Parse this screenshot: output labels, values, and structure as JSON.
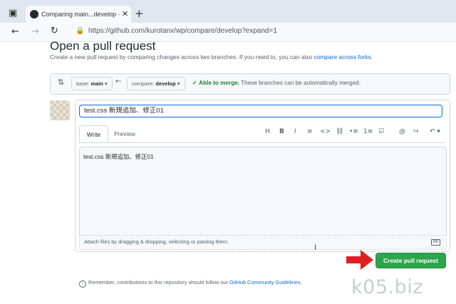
{
  "browser": {
    "tab_title": "Comparing main...develop · kuro",
    "url": "https://github.com/kurotanx/wp/compare/develop?expand=1",
    "icons": [
      "sidebar-toggle-icon",
      "github-favicon-icon",
      "close-tab-icon",
      "new-tab-icon",
      "back-icon",
      "forward-icon",
      "reload-icon",
      "lock-icon"
    ]
  },
  "page": {
    "heading": "Open a pull request",
    "subtitle_text": "Create a new pull request by comparing changes across two branches. If you need to, you can also ",
    "subtitle_link": "compare across forks",
    "subtitle_end": "."
  },
  "compare": {
    "base_prefix": "base:",
    "base_branch": "main",
    "compare_prefix": "compare:",
    "compare_branch": "develop",
    "merge_status": "Able to merge.",
    "merge_detail": "These branches can be automatically merged."
  },
  "form": {
    "title_value": "test.css 新規追加、修正01",
    "tab_write": "Write",
    "tab_preview": "Preview",
    "toolbar": [
      "H",
      "B",
      "I",
      "≡",
      "<>",
      "link",
      "•≡",
      "1≡",
      "☑",
      "@",
      "↪",
      "↶"
    ],
    "body_text": "test.css 新規追加、修正01",
    "attach_hint": "Attach files by dragging & dropping, selecting or pasting them.",
    "md_badge": "MD",
    "create_button": "Create pull request"
  },
  "footer": {
    "remember_text": "Remember, contributions to this repository should follow our ",
    "guidelines_link": "GitHub Community Guidelines",
    "remember_end": "."
  },
  "watermark": "k05.biz",
  "colors": {
    "accent": "#0969da",
    "success": "#2da44e",
    "arrow": "#e02020"
  }
}
